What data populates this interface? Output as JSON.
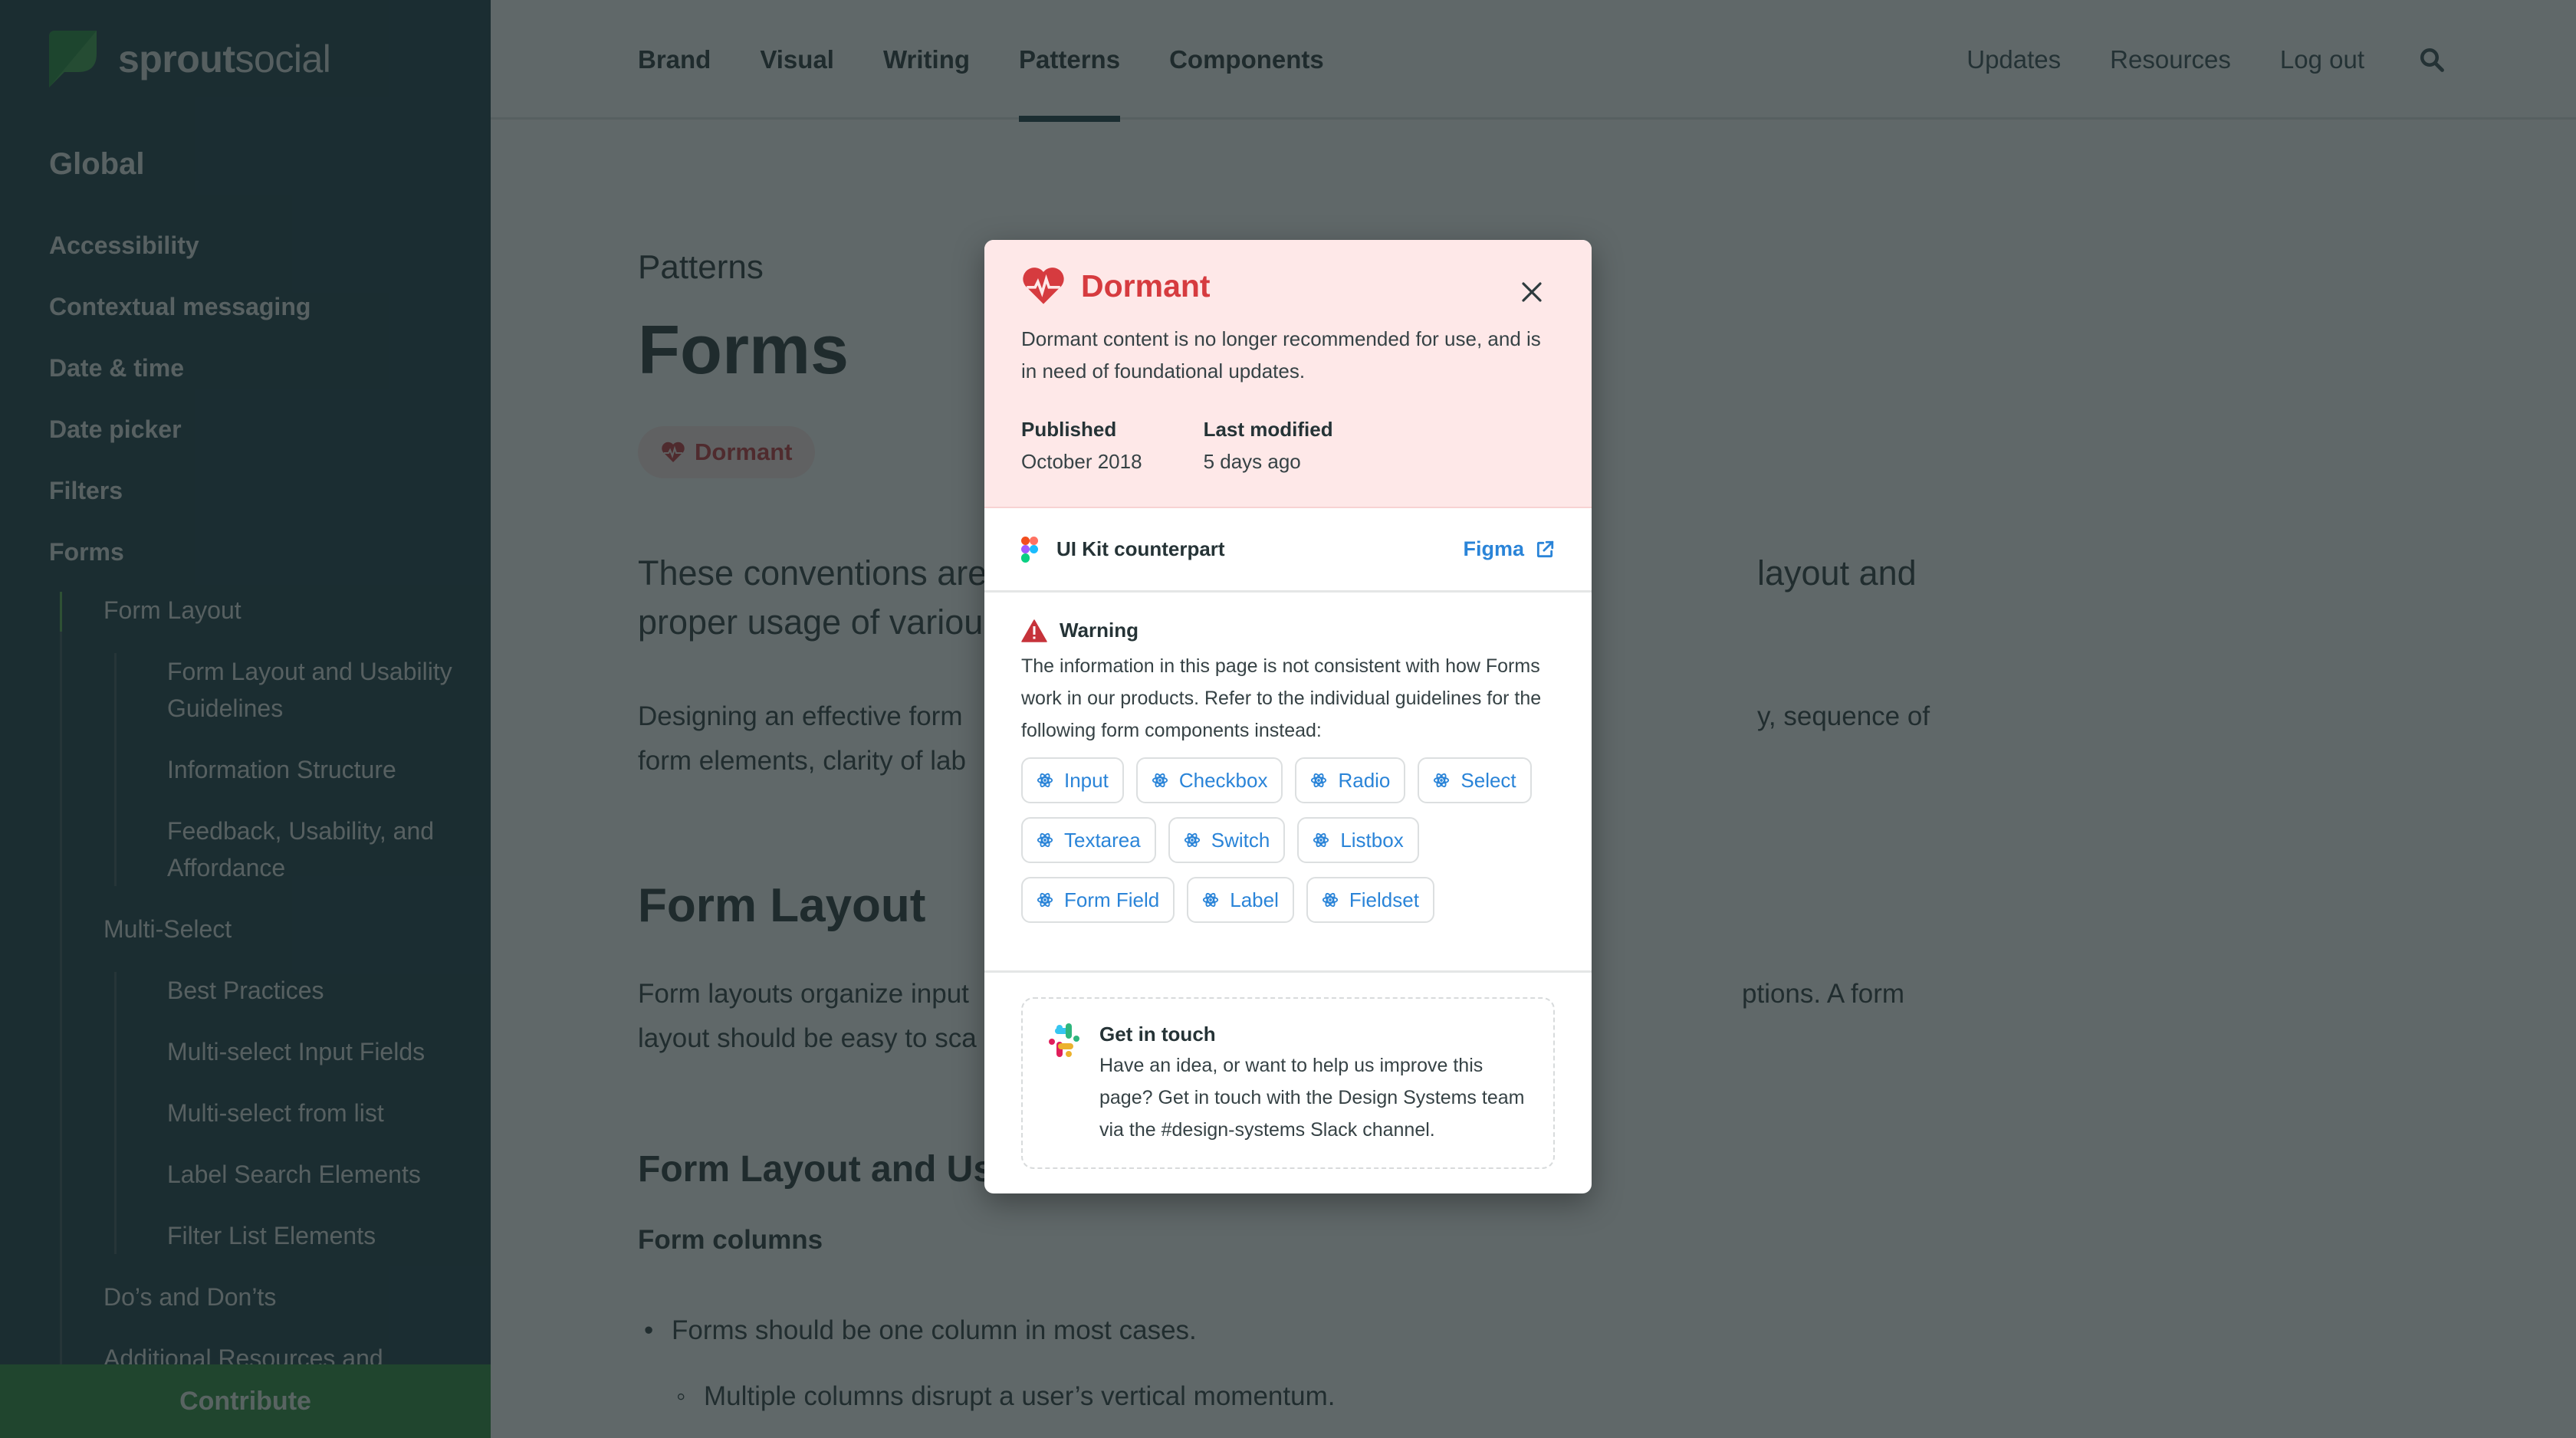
{
  "app": {
    "brand_bold": "sprout",
    "brand_light": "social"
  },
  "sidebar": {
    "heading": "Global",
    "items": [
      "Accessibility",
      "Contextual messaging",
      "Date & time",
      "Date picker",
      "Filters",
      "Forms"
    ],
    "subitems": [
      {
        "label": "Form Layout",
        "children": [
          "Form Layout and Usability Guidelines",
          "Information Structure",
          "Feedback, Usability, and Affordance"
        ]
      },
      {
        "label": "Multi-Select",
        "children": [
          "Best Practices",
          "Multi-select Input Fields",
          "Multi-select from list",
          "Label Search Elements",
          "Filter List Elements"
        ]
      },
      {
        "label": "Do’s and Don’ts",
        "children": []
      },
      {
        "label": "Additional Resources and",
        "children": []
      }
    ],
    "contribute_label": "Contribute"
  },
  "header": {
    "tabs": [
      "Brand",
      "Visual",
      "Writing",
      "Patterns",
      "Components"
    ],
    "active_tab": "Patterns",
    "links": [
      "Updates",
      "Resources",
      "Log out"
    ],
    "search_icon": "search-icon"
  },
  "main": {
    "eyebrow": "Patterns",
    "title": "Forms",
    "status": "Dormant",
    "lead": "These conventions are designed to help you with form layout and proper usage of various form elements.",
    "lead_visible": [
      "These conventions are",
      "layout and",
      "proper usage of variou"
    ],
    "p1_visible": [
      "Designing an effective form",
      "y, sequence of",
      "form elements, clarity of lab"
    ],
    "h2": "Form Layout",
    "p2_visible": [
      "Form layouts organize input",
      "ptions. A form",
      "layout should be easy to sca"
    ],
    "h3": "Form Layout and Us",
    "h4": "Form columns",
    "bullets": [
      "Forms should be one column in most cases."
    ],
    "sub_bullets": [
      "Multiple columns disrupt a user’s vertical momentum."
    ]
  },
  "modal": {
    "title": "Dormant",
    "description": "Dormant content is no longer recommended for use, and is in need of foundational updates.",
    "published_label": "Published",
    "published_value": "October 2018",
    "modified_label": "Last modified",
    "modified_value": "5 days ago",
    "kit_label": "UI Kit counterpart",
    "figma_label": "Figma",
    "warning_title": "Warning",
    "warning_body": "The information in this page is not consistent with how Forms work in our products. Refer to the individual guidelines for the following form components instead:",
    "components": [
      "Input",
      "Checkbox",
      "Radio",
      "Select",
      "Textarea",
      "Switch",
      "Listbox",
      "Form Field",
      "Label",
      "Fieldset"
    ],
    "touch_title": "Get in touch",
    "touch_body": "Have an idea, or want to help us improve this page? Get in touch with the Design Systems team via the #design-systems Slack channel."
  },
  "colors": {
    "sidebar_bg": "#1a3a44",
    "contribute_bg": "#2a8a3b",
    "dormant_red": "#d63b3f",
    "dormant_bg": "#fee8e8",
    "link_blue": "#2a84d8"
  }
}
